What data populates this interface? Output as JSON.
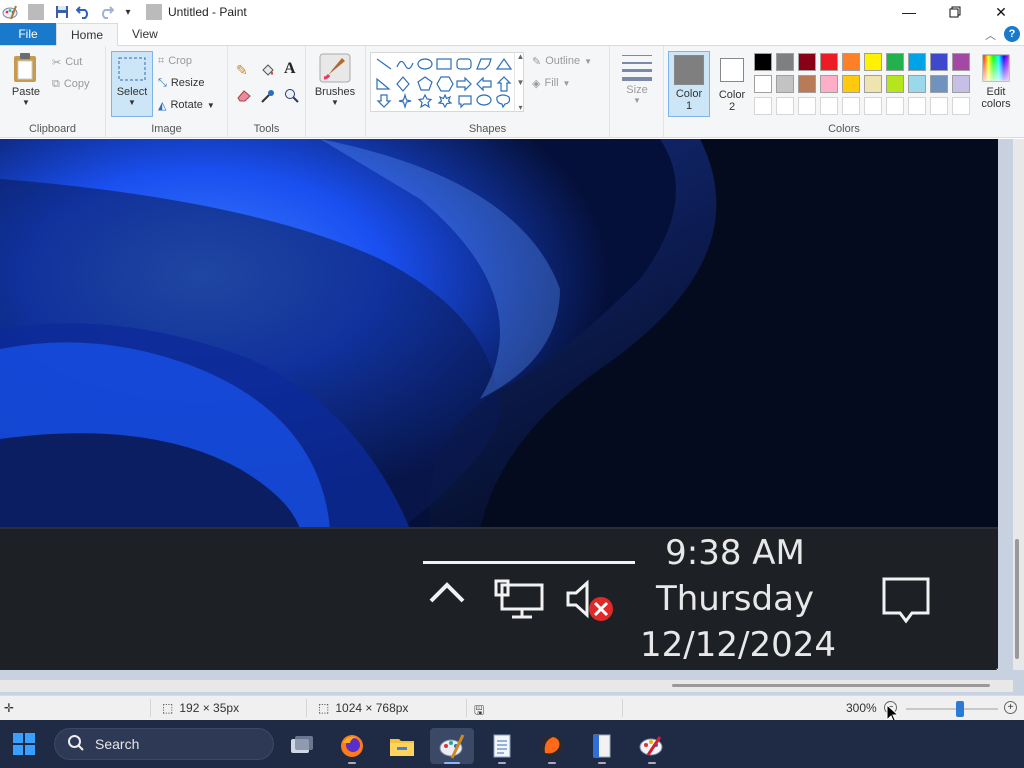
{
  "window": {
    "title": "Untitled - Paint",
    "minimize_icon": "minimize-icon",
    "restore_icon": "restore-icon",
    "close_icon": "close-icon"
  },
  "quick_access": {
    "items": [
      "paint-app-icon",
      "save-icon",
      "undo-icon",
      "redo-icon",
      "customize-dropdown-icon"
    ]
  },
  "tabs": [
    {
      "label": "File"
    },
    {
      "label": "Home"
    },
    {
      "label": "View"
    }
  ],
  "ribbon": {
    "clipboard": {
      "label": "Clipboard",
      "paste": "Paste",
      "cut": "Cut",
      "copy": "Copy"
    },
    "image": {
      "label": "Image",
      "select": "Select",
      "crop": "Crop",
      "resize": "Resize",
      "rotate": "Rotate"
    },
    "tools": {
      "label": "Tools"
    },
    "brushes": {
      "label": "Brushes"
    },
    "shapes": {
      "label": "Shapes",
      "outline": "Outline",
      "fill": "Fill"
    },
    "size": {
      "label": "Size"
    },
    "colors": {
      "label": "Colors",
      "color1": "Color",
      "color1_num": "1",
      "color2": "Color",
      "color2_num": "2",
      "edit_colors_line1": "Edit",
      "edit_colors_line2": "colors",
      "color1_value": "#7f7f7f",
      "color2_value": "#ffffff",
      "palette_row1": [
        "#000000",
        "#7f7f7f",
        "#880015",
        "#ed1c24",
        "#ff7f27",
        "#fff200",
        "#22b14c",
        "#00a2e8",
        "#3f48cc",
        "#a349a4"
      ],
      "palette_row2": [
        "#ffffff",
        "#c3c3c3",
        "#b97a57",
        "#ffaec9",
        "#ffc90e",
        "#efe4b0",
        "#b5e61d",
        "#99d9ea",
        "#7092be",
        "#c8bfe7"
      ]
    }
  },
  "canvas_content": {
    "clock_time": "9:38 AM",
    "clock_day": "Thursday",
    "clock_date": "12/12/2024"
  },
  "statusbar": {
    "selection_size": "192 × 35px",
    "image_size": "1024 × 768px",
    "zoom": "300%"
  },
  "taskbar": {
    "search_placeholder": "Search",
    "apps": [
      "task-view-icon",
      "firefox-icon",
      "file-explorer-icon",
      "paint-icon",
      "notepad-icon",
      "app-orange-icon",
      "book-icon",
      "paint-alt-icon"
    ]
  }
}
